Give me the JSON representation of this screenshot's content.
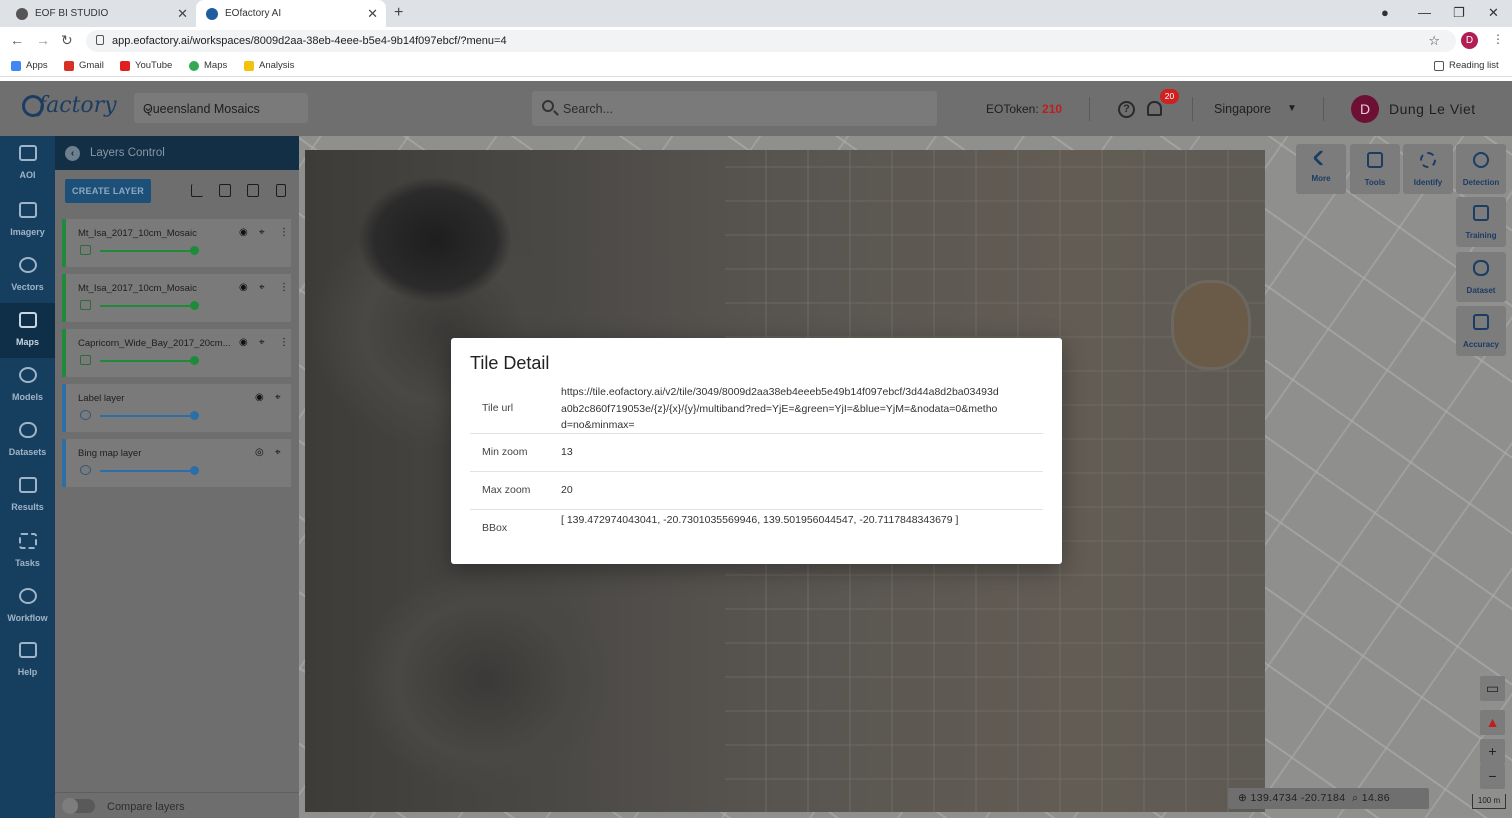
{
  "browser": {
    "tabs": [
      {
        "title": "EOF BI STUDIO",
        "active": false
      },
      {
        "title": "EOfactory AI",
        "active": true
      }
    ],
    "url": "app.eofactory.ai/workspaces/8009d2aa-38eb-4eee-b5e4-9b14f097ebcf/?menu=4",
    "profile_initial": "D",
    "bookmarks": [
      "Apps",
      "Gmail",
      "YouTube",
      "Maps",
      "Analysis"
    ],
    "reading_list": "Reading list"
  },
  "header": {
    "logo": "factory",
    "workspace": "Queensland Mosaics",
    "search_placeholder": "Search...",
    "eotoken_label": "EOToken:",
    "eotoken_value": "210",
    "notification_count": "20",
    "region": "Singapore",
    "user_initial": "D",
    "user_name": "Dung Le Viet"
  },
  "nav": [
    "AOI",
    "Imagery",
    "Vectors",
    "Maps",
    "Models",
    "Datasets",
    "Results",
    "Tasks",
    "Workflow",
    "Help"
  ],
  "nav_active": "Maps",
  "layers_panel": {
    "title": "Layers Control",
    "create_button": "CREATE LAYER",
    "layers": [
      {
        "name": "Mt_Isa_2017_10cm_Mosaic",
        "type": "raster"
      },
      {
        "name": "Mt_Isa_2017_10cm_Mosaic",
        "type": "raster"
      },
      {
        "name": "Capricorn_Wide_Bay_2017_20cm...",
        "type": "raster"
      },
      {
        "name": "Label layer",
        "type": "basemap"
      },
      {
        "name": "Bing map layer",
        "type": "basemap"
      }
    ],
    "compare_label": "Compare layers"
  },
  "map_tools": {
    "top": [
      "More",
      "Tools",
      "Identify",
      "Detection"
    ],
    "side": [
      "Training",
      "Dataset",
      "Accuracy"
    ],
    "coords": "139.4734 -20.7184",
    "zoom": "14.86",
    "scale": "100 m"
  },
  "modal": {
    "title": "Tile Detail",
    "rows": [
      {
        "key": "Tile url",
        "value": "https://tile.eofactory.ai/v2/tile/3049/8009d2aa38eb4eeeb5e49b14f097ebcf/3d44a8d2ba03493da0b2c860f719053e/{z}/{x}/{y}/multiband?red=YjE=&green=YjI=&blue=YjM=&nodata=0&method=no&minmax="
      },
      {
        "key": "Min zoom",
        "value": "13"
      },
      {
        "key": "Max zoom",
        "value": "20"
      },
      {
        "key": "BBox",
        "value": "[ 139.472974043041, -20.7301035569946, 139.501956044547, -20.7117848343679 ]"
      }
    ]
  },
  "colors": {
    "nav_bg": "#163f5f",
    "accent_green": "#1e8a3a",
    "accent_blue": "#2c6ea6",
    "token_red": "#c21d1d"
  }
}
